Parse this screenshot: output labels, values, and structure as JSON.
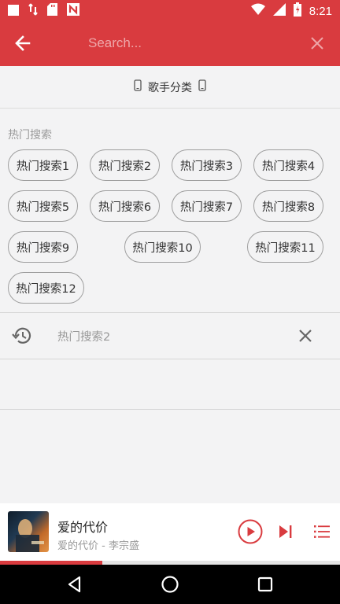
{
  "status_bar": {
    "time": "8:21"
  },
  "search": {
    "placeholder": "Search..."
  },
  "category": {
    "label": "歌手分类"
  },
  "hot": {
    "title": "热门搜索",
    "chips": [
      "热门搜索1",
      "热门搜索2",
      "热门搜索3",
      "热门搜索4",
      "热门搜索5",
      "热门搜索6",
      "热门搜索7",
      "热门搜索8",
      "热门搜索9",
      "热门搜索10",
      "热门搜索11",
      "热门搜索12"
    ]
  },
  "history": {
    "items": [
      "热门搜索2"
    ]
  },
  "player": {
    "title": "爱的代价",
    "subtitle": "爱的代价 - 李宗盛",
    "progress_percent": 30
  },
  "colors": {
    "accent": "#d93b3f",
    "background": "#f3f3f4"
  },
  "icons": {
    "status_left": [
      "notification-square-icon",
      "usb-icon",
      "sd-card-icon",
      "n-app-icon"
    ],
    "status_right": [
      "wifi-icon",
      "signal-icon",
      "battery-charging-icon"
    ]
  }
}
